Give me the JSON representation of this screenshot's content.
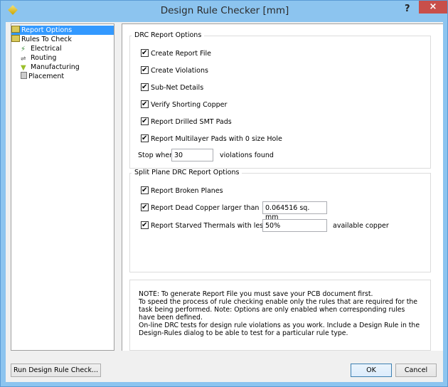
{
  "window": {
    "title": "Design Rule Checker [mm]",
    "help": "?",
    "close": "×"
  },
  "tree": [
    {
      "label": "Report Options",
      "icon": "folder-icon",
      "selected": true
    },
    {
      "label": "Rules To Check",
      "icon": "folder-icon"
    },
    {
      "label": "Electrical",
      "icon": "electrical-icon"
    },
    {
      "label": "Routing",
      "icon": "routing-icon"
    },
    {
      "label": "Manufacturing",
      "icon": "manufacturing-icon"
    },
    {
      "label": "Placement",
      "icon": "placement-icon"
    }
  ],
  "drc": {
    "legend": "DRC Report Options",
    "options": [
      {
        "label": "Create Report File",
        "checked": true
      },
      {
        "label": "Create Violations",
        "checked": true
      },
      {
        "label": "Sub-Net Details",
        "checked": true
      },
      {
        "label": "Verify Shorting Copper",
        "checked": true
      },
      {
        "label": "Report Drilled SMT Pads",
        "checked": true
      },
      {
        "label": "Report Multilayer Pads with 0 size Hole",
        "checked": true
      }
    ],
    "stop_label": "Stop when",
    "stop_value": "30",
    "stop_suffix": "violations found"
  },
  "split": {
    "legend": "Split Plane DRC Report Options",
    "broken": "Report Broken Planes",
    "dead": "Report Dead Copper larger than",
    "dead_value": "0.064516 sq. mm",
    "starved": "Report Starved Thermals with less than",
    "starved_value": "50%",
    "starved_suffix": "available copper"
  },
  "note": [
    "NOTE: To generate Report File you must save your PCB document first.",
    "To speed the process of rule checking enable only the rules that are required for the task being performed.  Note: Options are only enabled when corresponding rules have been defined.",
    "On-line DRC tests for design rule violations as you work. Include a Design Rule in the Design-Rules dialog to be able to test for a particular rule  type."
  ],
  "buttons": {
    "run": "Run Design Rule Check...",
    "ok": "OK",
    "cancel": "Cancel"
  }
}
